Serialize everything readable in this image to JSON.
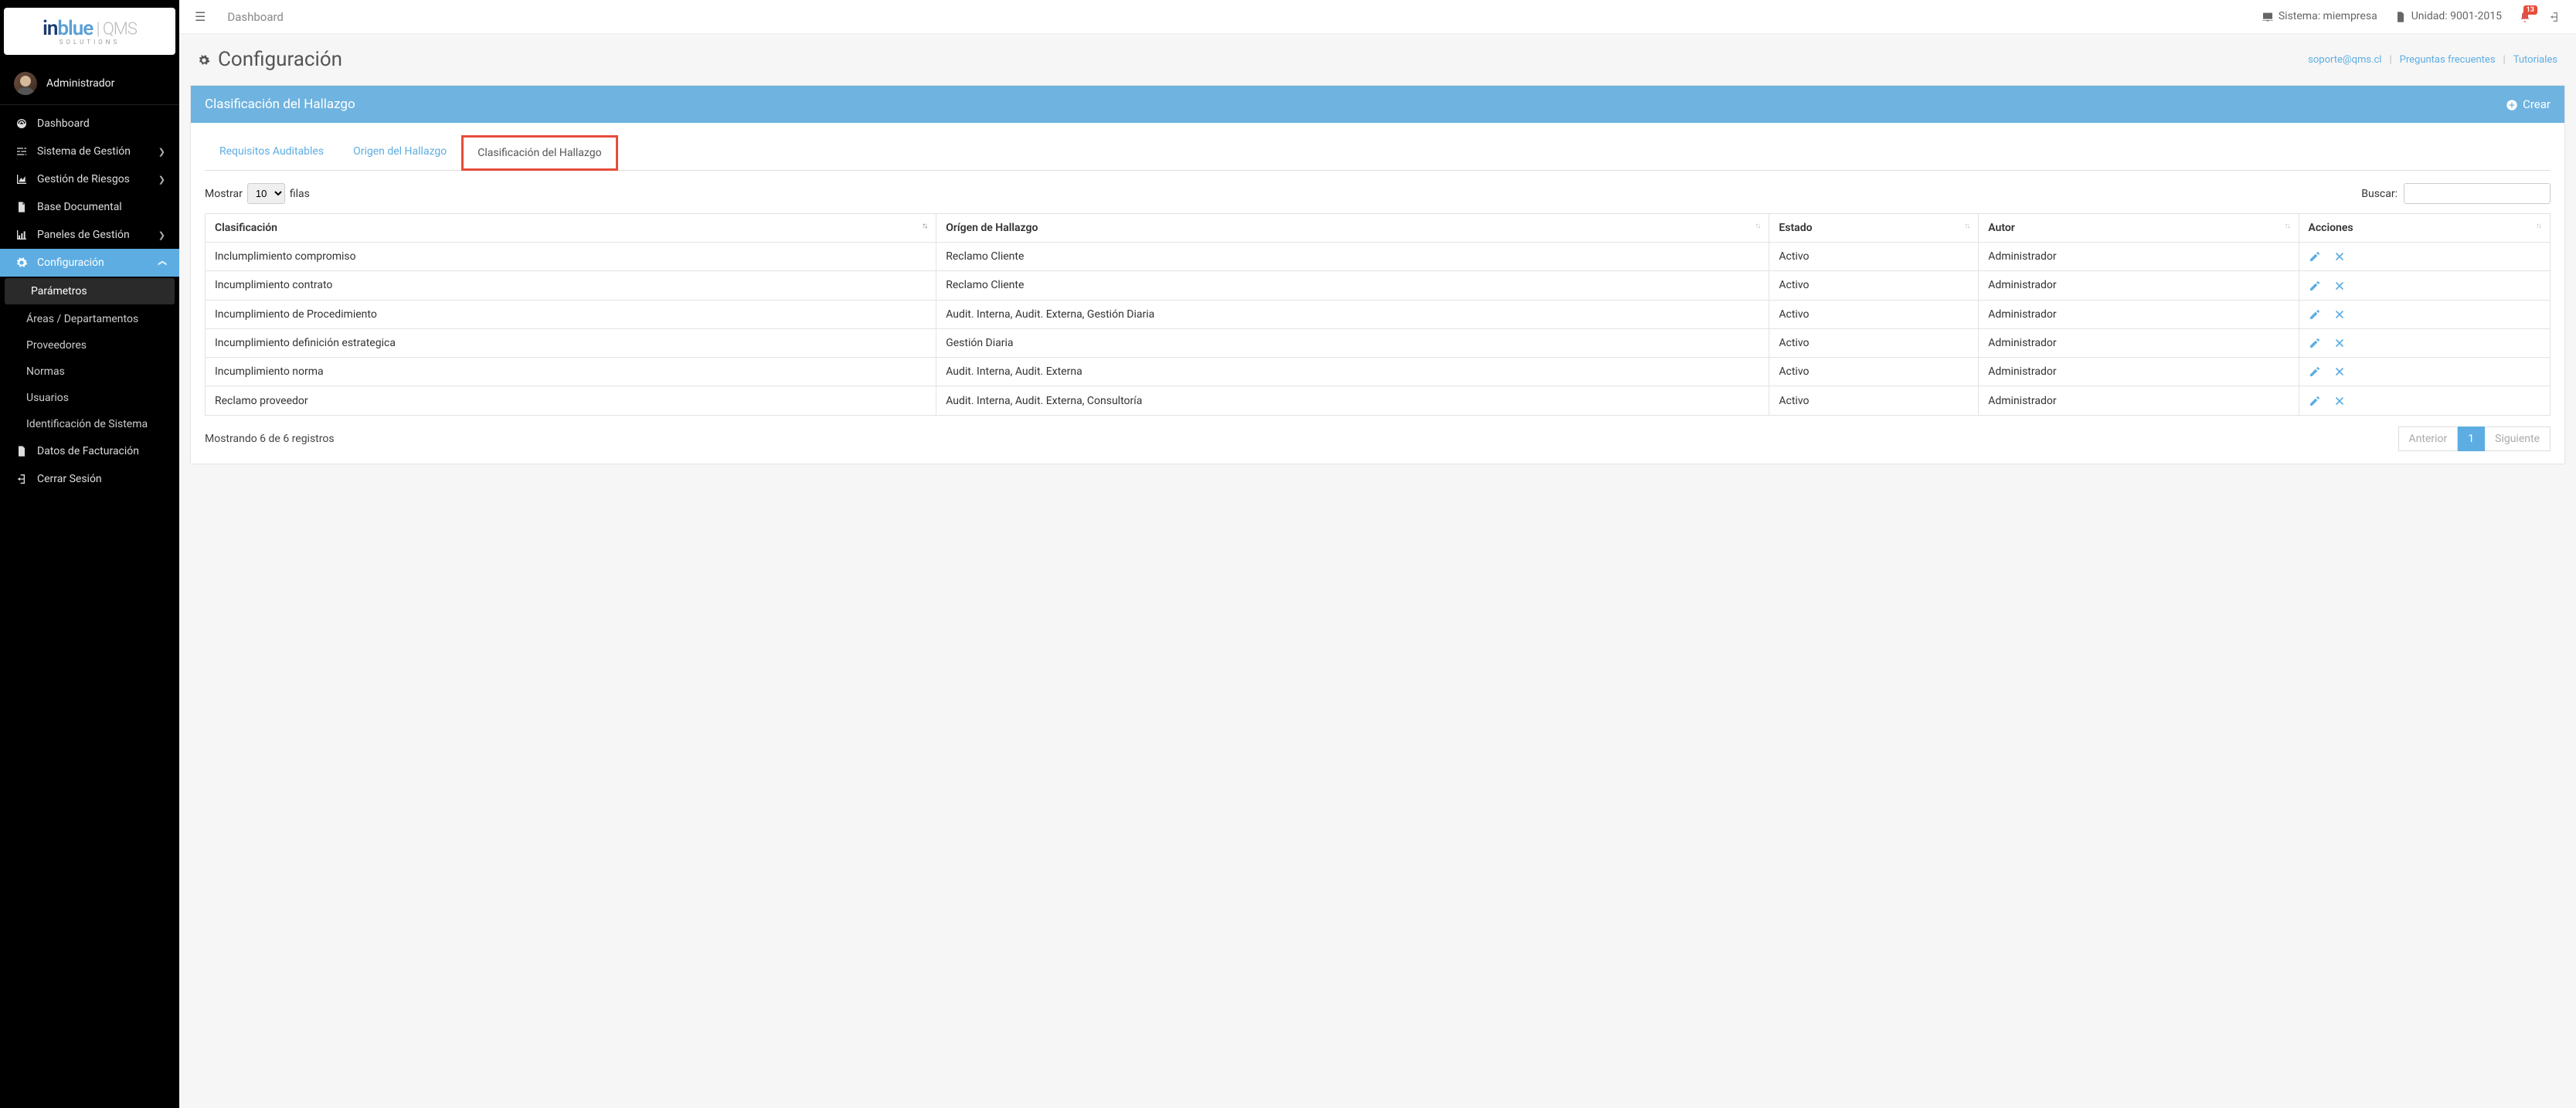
{
  "brand": {
    "part1": "in",
    "part2": "blue",
    "qms": " | QMS",
    "sub": "Solutions"
  },
  "user": {
    "name": "Administrador"
  },
  "sidebar": {
    "items": [
      {
        "label": "Dashboard",
        "icon": "gauge"
      },
      {
        "label": "Sistema de Gestión",
        "icon": "sliders",
        "expandable": true
      },
      {
        "label": "Gestión de Riesgos",
        "icon": "chart-area",
        "expandable": true
      },
      {
        "label": "Base Documental",
        "icon": "file"
      },
      {
        "label": "Paneles de Gestión",
        "icon": "bars",
        "expandable": true
      },
      {
        "label": "Configuración",
        "icon": "gear",
        "expandable": true,
        "active": true
      },
      {
        "label": "Datos de Facturación",
        "icon": "file-text"
      },
      {
        "label": "Cerrar Sesión",
        "icon": "signout"
      }
    ],
    "config_sub": [
      {
        "label": "Parámetros",
        "selected": true
      },
      {
        "label": "Áreas / Departamentos"
      },
      {
        "label": "Proveedores"
      },
      {
        "label": "Normas"
      },
      {
        "label": "Usuarios"
      },
      {
        "label": "Identificación de Sistema"
      }
    ]
  },
  "topbar": {
    "breadcrumb": "Dashboard",
    "sistema_label": "Sistema: miempresa",
    "unidad_label": "Unidad: 9001-2015",
    "notif_count": "13"
  },
  "page": {
    "title": "Configuración",
    "links": {
      "soporte": "soporte@qms.cl",
      "faq": "Preguntas frecuentes",
      "tutoriales": "Tutoriales"
    }
  },
  "panel": {
    "title": "Clasificación del Hallazgo",
    "create_label": "Crear",
    "tabs": [
      {
        "label": "Requisitos Auditables"
      },
      {
        "label": "Origen del Hallazgo"
      },
      {
        "label": "Clasificación del Hallazgo",
        "active": true
      }
    ]
  },
  "table": {
    "show_prefix": "Mostrar",
    "show_suffix": "filas",
    "page_size": "10",
    "search_label": "Buscar:",
    "columns": [
      "Clasificación",
      "Orígen de Hallazgo",
      "Estado",
      "Autor",
      "Acciones"
    ],
    "rows": [
      {
        "c0": "Inclumplimiento compromiso",
        "c1": "Reclamo Cliente",
        "c2": "Activo",
        "c3": "Administrador"
      },
      {
        "c0": "Incumplimiento contrato",
        "c1": "Reclamo Cliente",
        "c2": "Activo",
        "c3": "Administrador"
      },
      {
        "c0": "Incumplimiento de Procedimiento",
        "c1": "Audit. Interna, Audit. Externa, Gestión Diaria",
        "c2": "Activo",
        "c3": "Administrador"
      },
      {
        "c0": "Incumplimiento definición estrategica",
        "c1": "Gestión Diaria",
        "c2": "Activo",
        "c3": "Administrador"
      },
      {
        "c0": "Incumplimiento norma",
        "c1": "Audit. Interna, Audit. Externa",
        "c2": "Activo",
        "c3": "Administrador"
      },
      {
        "c0": "Reclamo proveedor",
        "c1": "Audit. Interna, Audit. Externa, Consultoría",
        "c2": "Activo",
        "c3": "Administrador"
      }
    ],
    "footer_info": "Mostrando 6 de 6 registros",
    "prev": "Anterior",
    "next": "Siguiente",
    "page_current": "1"
  }
}
